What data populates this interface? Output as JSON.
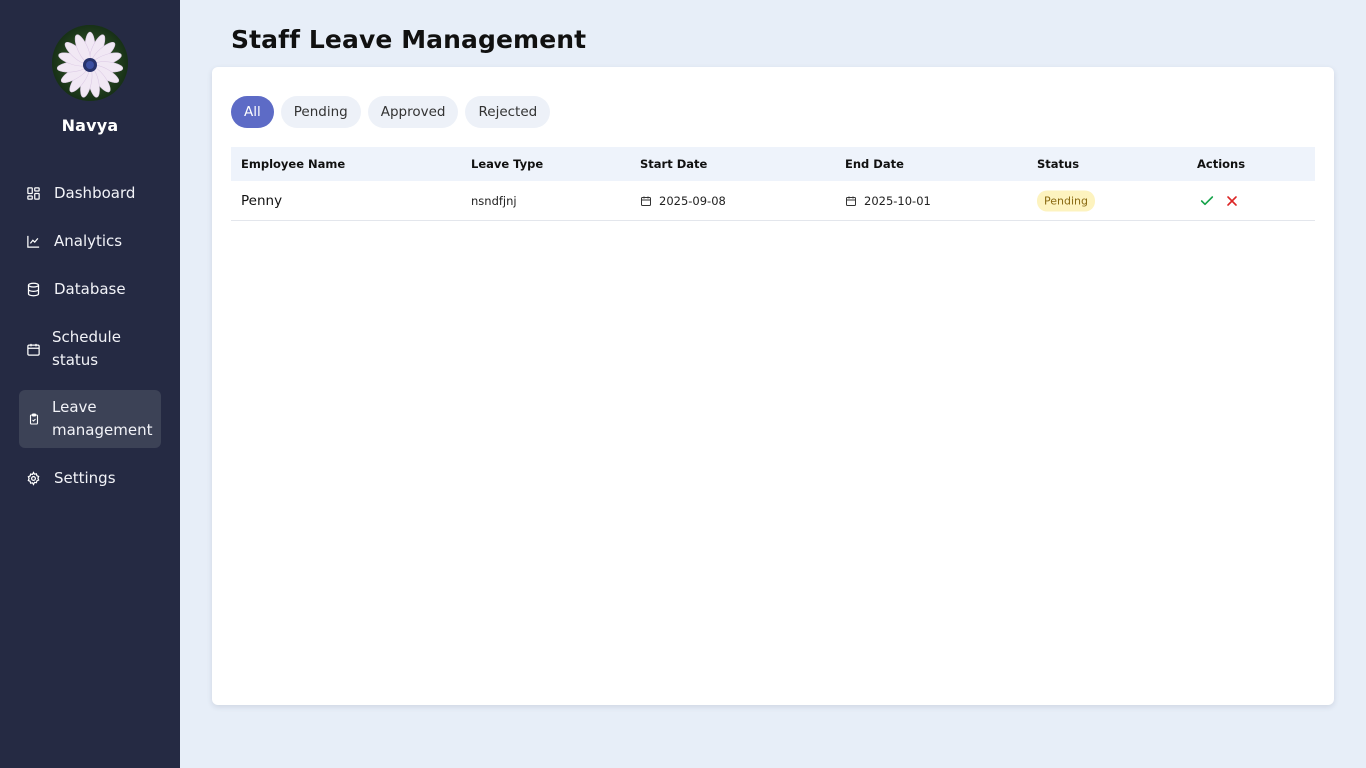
{
  "user": {
    "name": "Navya"
  },
  "sidebar": {
    "items": [
      {
        "label": "Dashboard",
        "icon": "dashboard-icon",
        "active": false
      },
      {
        "label": "Analytics",
        "icon": "chart-line-icon",
        "active": false
      },
      {
        "label": "Database",
        "icon": "database-icon",
        "active": false
      },
      {
        "label": "Schedule status",
        "icon": "calendar-icon",
        "active": false
      },
      {
        "label": "Leave management",
        "icon": "clipboard-icon",
        "active": true
      },
      {
        "label": "Settings",
        "icon": "gear-icon",
        "active": false
      }
    ]
  },
  "page": {
    "title": "Staff Leave Management"
  },
  "filters": [
    {
      "label": "All",
      "active": true
    },
    {
      "label": "Pending",
      "active": false
    },
    {
      "label": "Approved",
      "active": false
    },
    {
      "label": "Rejected",
      "active": false
    }
  ],
  "table": {
    "headers": {
      "employee_name": "Employee Name",
      "leave_type": "Leave Type",
      "start_date": "Start Date",
      "end_date": "End Date",
      "status": "Status",
      "actions": "Actions"
    },
    "rows": [
      {
        "employee_name": "Penny",
        "leave_type": "nsndfjnj",
        "start_date": "2025-09-08",
        "end_date": "2025-10-01",
        "status": "Pending"
      }
    ]
  },
  "colors": {
    "sidebar_bg": "#252a43",
    "page_bg": "#e7eef8",
    "accent": "#5d6bc6",
    "approve": "#16a34a",
    "reject": "#dc2626",
    "pending_badge_bg": "#fdf3bf",
    "pending_badge_text": "#8a6a12"
  }
}
